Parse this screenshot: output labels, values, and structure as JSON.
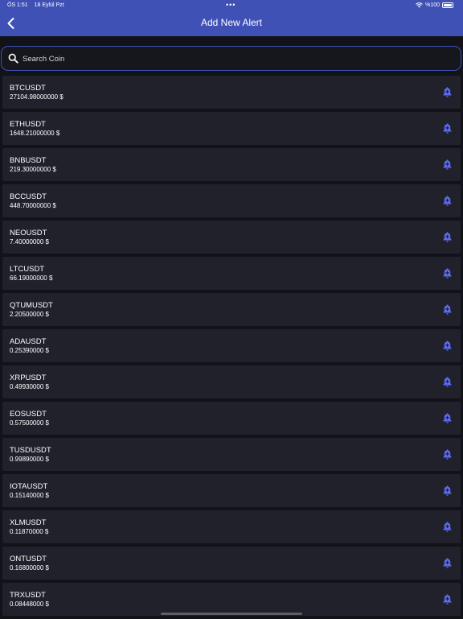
{
  "status": {
    "time": "ÖS 1:51",
    "date": "18 Eylül Pzt",
    "dots": "•••",
    "battery": "%100"
  },
  "header": {
    "title": "Add New Alert",
    "back_icon": "chevron-left-icon"
  },
  "search": {
    "placeholder": "Search Coin",
    "value": ""
  },
  "coins": [
    {
      "symbol": "BTCUSDT",
      "price": "27104.98000000 $"
    },
    {
      "symbol": "ETHUSDT",
      "price": "1648.21000000 $"
    },
    {
      "symbol": "BNBUSDT",
      "price": "219.30000000 $"
    },
    {
      "symbol": "BCCUSDT",
      "price": "448.70000000 $"
    },
    {
      "symbol": "NEOUSDT",
      "price": "7.40000000 $"
    },
    {
      "symbol": "LTCUSDT",
      "price": "66.19000000 $"
    },
    {
      "symbol": "QTUMUSDT",
      "price": "2.20500000 $"
    },
    {
      "symbol": "ADAUSDT",
      "price": "0.25390000 $"
    },
    {
      "symbol": "XRPUSDT",
      "price": "0.49930000 $"
    },
    {
      "symbol": "EOSUSDT",
      "price": "0.57500000 $"
    },
    {
      "symbol": "TUSDUSDT",
      "price": "0.99890000 $"
    },
    {
      "symbol": "IOTAUSDT",
      "price": "0.15140000 $"
    },
    {
      "symbol": "XLMUSDT",
      "price": "0.11870000 $"
    },
    {
      "symbol": "ONTUSDT",
      "price": "0.16800000 $"
    },
    {
      "symbol": "TRXUSDT",
      "price": "0.08448000 $"
    }
  ],
  "colors": {
    "header": "#3f51b5",
    "background": "#121219",
    "row": "#20212b",
    "bell": "#5c6bf0"
  }
}
